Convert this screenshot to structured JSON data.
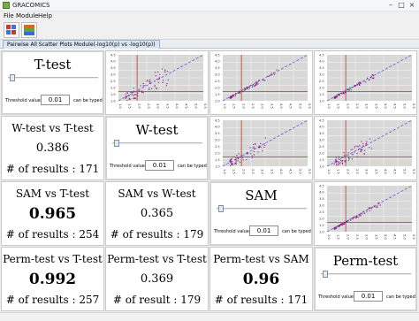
{
  "window": {
    "title": "GRACOMICS"
  },
  "menu": [
    "File",
    "Module",
    "Help"
  ],
  "tab": {
    "label": "Pairwise All Scatter Plots Module(-log10(p) vs -log10(p))"
  },
  "diagonal": [
    {
      "name": "T-test",
      "threshold_label": "Threshold value",
      "threshold_value": "0.01",
      "hint": "can be typed",
      "slider_fraction": 0.02
    },
    {
      "name": "W-test",
      "threshold_label": "Threshold value",
      "threshold_value": "0.01",
      "hint": "can be typed",
      "slider_fraction": 0.02
    },
    {
      "name": "SAM",
      "threshold_label": "Threshold value",
      "threshold_value": "0.01",
      "hint": "can be typed",
      "slider_fraction": 0.02
    },
    {
      "name": "Perm-test",
      "threshold_label": "Threshold value",
      "threshold_value": "0.01",
      "hint": "can be typed",
      "slider_fraction": 0.02
    }
  ],
  "stats": [
    {
      "title": "W-test vs T-test",
      "value": "0.386",
      "count": "# of results : 171",
      "emph": false
    },
    {
      "title": "SAM vs T-test",
      "value": "0.965",
      "count": "# of results : 254",
      "emph": true
    },
    {
      "title": "SAM vs W-test",
      "value": "0.365",
      "count": "# of results : 179",
      "emph": false
    },
    {
      "title": "Perm-test vs T-test",
      "value": "0.992",
      "count": "# of results : 257",
      "emph": true
    },
    {
      "title": "Perm-test vs T-test",
      "value": "0.369",
      "count": "# of result : 179",
      "emph": false
    },
    {
      "title": "Perm-test vs SAM",
      "value": "0.96",
      "count": "# of results : 171",
      "emph": true
    }
  ],
  "plot_axis": {
    "xticks": [
      "1.0",
      "1.5",
      "2.0",
      "2.5",
      "3.0",
      "3.5",
      "4.0",
      "4.5",
      "5.0",
      "5.5"
    ],
    "yticks": [
      "1.0",
      "1.5",
      "2.0",
      "2.5",
      "3.0",
      "3.5",
      "4.0",
      "4.5"
    ]
  },
  "colors": {
    "point": "#8b1a7a",
    "diagonal": "#5a5fd6",
    "threshold": "#d62a2a",
    "plot_bg": "#d8d8d8",
    "grid": "#f2f2f2"
  }
}
